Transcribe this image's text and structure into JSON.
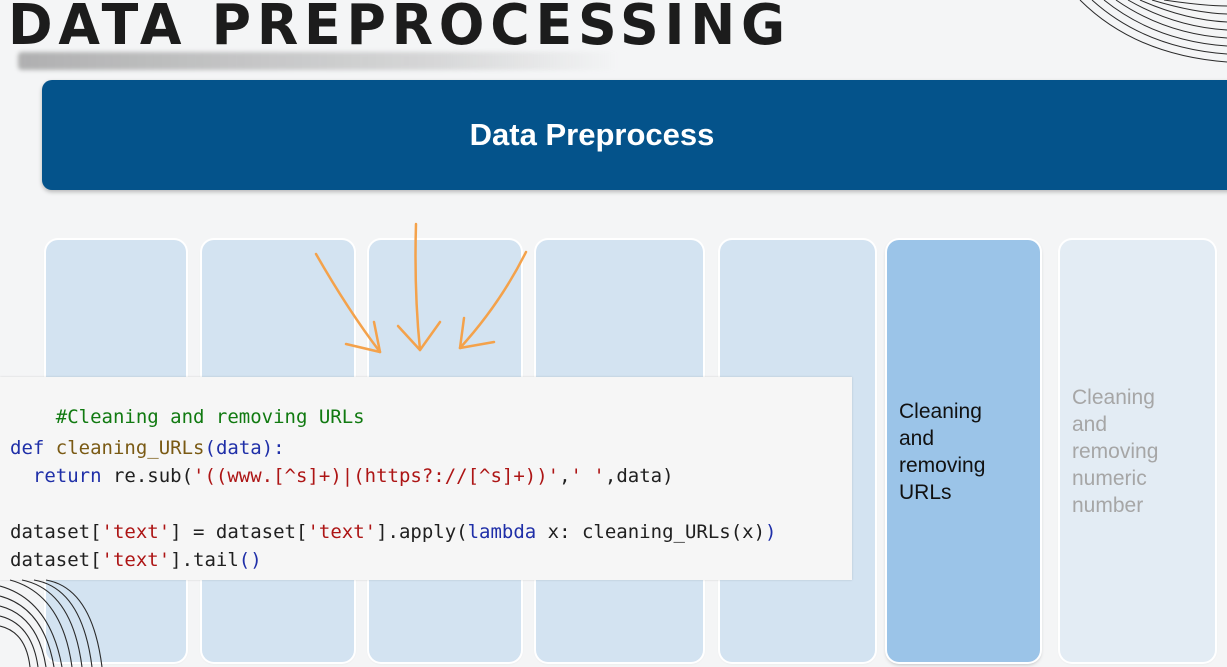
{
  "slide": {
    "title": "DATA PREPROCESSING",
    "banner_label": "Data Preprocess"
  },
  "cards": [
    {
      "label": ""
    },
    {
      "label": ""
    },
    {
      "label": ""
    },
    {
      "label": ""
    },
    {
      "label": ""
    },
    {
      "label": "Cleaning\nand\nremoving\nURLs",
      "state": "active"
    },
    {
      "label": "Cleaning\nand\nremoving\nnumeric\nnumber",
      "state": "faded"
    }
  ],
  "code": {
    "comment": "#Cleaning and removing URLs",
    "def_kw": "def",
    "func_name": "cleaning_URLs",
    "param": "(data):",
    "return_kw": "return",
    "re_sub": " re.sub(",
    "pattern": "'((www.[^s]+)|(https?://[^s]+))'",
    "comma1": ",",
    "repl": "' '",
    "tail_args": ",data)",
    "line4_a": "dataset[",
    "line4_key1": "'text'",
    "line4_b": "] = dataset[",
    "line4_key2": "'text'",
    "line4_c": "].apply(",
    "lambda_kw": "lambda",
    "line4_d": " x: cleaning_URLs(x)",
    "line4_e": ")",
    "line5_a": "dataset[",
    "line5_key": "'text'",
    "line5_b": "].tail",
    "line5_c": "()"
  },
  "colors": {
    "banner": "#04538b",
    "card": "#d3e3f1",
    "card_active": "#9bc4e8",
    "arrow": "#f4a24b"
  }
}
